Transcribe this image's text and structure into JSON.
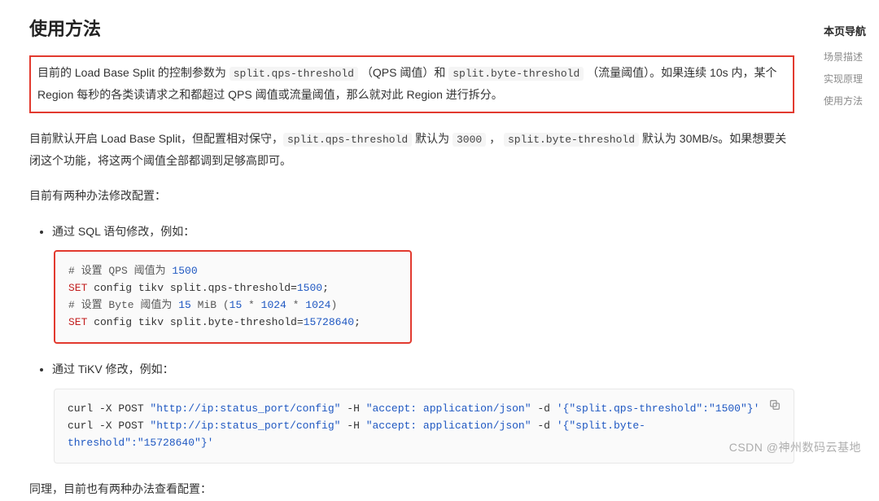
{
  "heading": "使用方法",
  "toc": {
    "title": "本页导航",
    "items": [
      "场景描述",
      "实现原理",
      "使用方法"
    ]
  },
  "para1": {
    "t1": "目前的 Load Base Split 的控制参数为 ",
    "c1": "split.qps-threshold",
    "t2": " （QPS 阈值）和 ",
    "c2": "split.byte-threshold",
    "t3": " （流量阈值）。如果连续 10s 内，某个 Region 每秒的各类读请求之和都超过 QPS 阈值或流量阈值，那么就对此 Region 进行拆分。"
  },
  "para2": {
    "t1": "目前默认开启 Load Base Split，但配置相对保守，",
    "c1": "split.qps-threshold",
    "t2": " 默认为 ",
    "c2": "3000",
    "t3": " ， ",
    "c3": "split.byte-threshold",
    "t4": " 默认为 30MB/s。如果想要关闭这个功能，将这两个阈值全部都调到足够高即可。"
  },
  "para3": "目前有两种办法修改配置：",
  "bullet1": "通过 SQL 语句修改，例如：",
  "bullet2": "通过 TiKV 修改，例如：",
  "code1": {
    "l1_cmt1": "# 设置 QPS 阈值为 ",
    "l1_num": "1500",
    "l2_kw": "SET",
    "l2_rest": " config tikv split.qps-threshold=",
    "l2_num": "1500",
    "l3_cmt1": "# 设置 Byte 阈值为 ",
    "l3_num1": "15",
    "l3_cmt2": " MiB (",
    "l3_num2": "15",
    "l3_cmt3": " * ",
    "l3_num3": "1024",
    "l3_cmt4": " * ",
    "l3_num4": "1024",
    "l3_cmt5": ")",
    "l4_kw": "SET",
    "l4_rest": " config tikv split.byte-threshold=",
    "l4_num": "15728640"
  },
  "code2": {
    "l1a": "curl -X POST ",
    "l1u": "\"http://ip:status_port/config\"",
    "l1b": " -H ",
    "l1h": "\"accept: application/json\"",
    "l1c": " -d ",
    "l1d": "'{\"split.qps-threshold\":\"1500\"}'",
    "l2a": "curl -X POST ",
    "l2u": "\"http://ip:status_port/config\"",
    "l2b": " -H ",
    "l2h": "\"accept: application/json\"",
    "l2c": " -d ",
    "l2d": "'{\"split.byte-threshold\":\"15728640\"}'"
  },
  "para4": "同理，目前也有两种办法查看配置：",
  "watermark": "CSDN @神州数码云基地"
}
